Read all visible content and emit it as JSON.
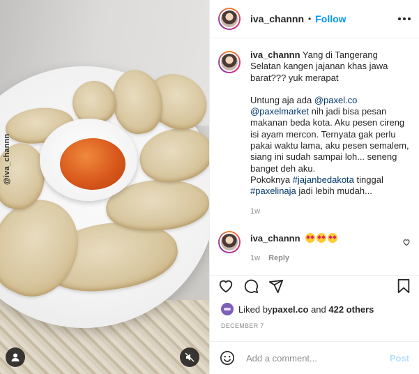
{
  "photo": {
    "watermark": "@iva_channn",
    "alt": "",
    "user_tag_icon": "user-icon",
    "mute_icon": "muted-speaker-icon"
  },
  "header": {
    "username": "iva_channn",
    "separator": "•",
    "follow_label": "Follow",
    "more_icon": "more-options-icon"
  },
  "caption": {
    "username": "iva_channn",
    "line1": "Yang di Tangerang Selatan kangen jajanan khas jawa barat??? yuk merapat",
    "p2_prefix": "Untung aja ada ",
    "mention1": "@paxel.co",
    "mention2": "@paxelmarket",
    "p2_rest": " nih jadi bisa pesan makanan beda kota. Aku pesen cireng isi ayam mercon. Ternyata gak perlu pakai waktu lama, aku pesen semalem, siang ini sudah sampai loh... seneng banget deh aku.",
    "p3_prefix": "Pokoknya ",
    "hashtag1": "#jajanbedakota",
    "p3_mid": " tinggal ",
    "hashtag2": "#paxelinaja",
    "p3_rest": " jadi lebih mudah...",
    "time": "1w"
  },
  "reply": {
    "username": "iva_channn",
    "time": "1w",
    "reply_label": "Reply",
    "heart_icon": "heart-outline-icon"
  },
  "actions": {
    "like_icon": "heart-icon",
    "comment_icon": "comment-icon",
    "share_icon": "send-icon",
    "save_icon": "bookmark-icon"
  },
  "likes": {
    "prefix": "Liked by ",
    "user": "paxel.co",
    "mid": " and ",
    "others": "422 others"
  },
  "date": "DECEMBER 7",
  "add_comment": {
    "placeholder": "Add a comment...",
    "post_label": "Post",
    "emoji_icon": "smiley-icon"
  },
  "colors": {
    "accent": "#0095f6",
    "link": "#00376b",
    "muted": "#8e8e8e",
    "post_disabled": "#b2dffc"
  }
}
